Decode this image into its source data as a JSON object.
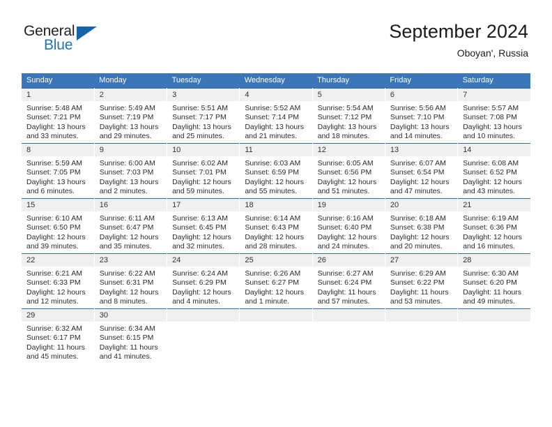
{
  "brand": {
    "name_top": "General",
    "name_bottom": "Blue",
    "triangle_color": "#1565a8",
    "blue_text_color": "#1d72b8"
  },
  "header": {
    "title": "September 2024",
    "subtitle": "Oboyan', Russia"
  },
  "calendar": {
    "header_bg": "#3a76b8",
    "header_text_color": "#ffffff",
    "row_divider_color": "#2e6da4",
    "daynum_band_bg": "#f0f0f0",
    "weekdays": [
      "Sunday",
      "Monday",
      "Tuesday",
      "Wednesday",
      "Thursday",
      "Friday",
      "Saturday"
    ],
    "weeks": [
      [
        {
          "day": "1",
          "sunrise": "Sunrise: 5:48 AM",
          "sunset": "Sunset: 7:21 PM",
          "daylight_line1": "Daylight: 13 hours",
          "daylight_line2": "and 33 minutes."
        },
        {
          "day": "2",
          "sunrise": "Sunrise: 5:49 AM",
          "sunset": "Sunset: 7:19 PM",
          "daylight_line1": "Daylight: 13 hours",
          "daylight_line2": "and 29 minutes."
        },
        {
          "day": "3",
          "sunrise": "Sunrise: 5:51 AM",
          "sunset": "Sunset: 7:17 PM",
          "daylight_line1": "Daylight: 13 hours",
          "daylight_line2": "and 25 minutes."
        },
        {
          "day": "4",
          "sunrise": "Sunrise: 5:52 AM",
          "sunset": "Sunset: 7:14 PM",
          "daylight_line1": "Daylight: 13 hours",
          "daylight_line2": "and 21 minutes."
        },
        {
          "day": "5",
          "sunrise": "Sunrise: 5:54 AM",
          "sunset": "Sunset: 7:12 PM",
          "daylight_line1": "Daylight: 13 hours",
          "daylight_line2": "and 18 minutes."
        },
        {
          "day": "6",
          "sunrise": "Sunrise: 5:56 AM",
          "sunset": "Sunset: 7:10 PM",
          "daylight_line1": "Daylight: 13 hours",
          "daylight_line2": "and 14 minutes."
        },
        {
          "day": "7",
          "sunrise": "Sunrise: 5:57 AM",
          "sunset": "Sunset: 7:08 PM",
          "daylight_line1": "Daylight: 13 hours",
          "daylight_line2": "and 10 minutes."
        }
      ],
      [
        {
          "day": "8",
          "sunrise": "Sunrise: 5:59 AM",
          "sunset": "Sunset: 7:05 PM",
          "daylight_line1": "Daylight: 13 hours",
          "daylight_line2": "and 6 minutes."
        },
        {
          "day": "9",
          "sunrise": "Sunrise: 6:00 AM",
          "sunset": "Sunset: 7:03 PM",
          "daylight_line1": "Daylight: 13 hours",
          "daylight_line2": "and 2 minutes."
        },
        {
          "day": "10",
          "sunrise": "Sunrise: 6:02 AM",
          "sunset": "Sunset: 7:01 PM",
          "daylight_line1": "Daylight: 12 hours",
          "daylight_line2": "and 59 minutes."
        },
        {
          "day": "11",
          "sunrise": "Sunrise: 6:03 AM",
          "sunset": "Sunset: 6:59 PM",
          "daylight_line1": "Daylight: 12 hours",
          "daylight_line2": "and 55 minutes."
        },
        {
          "day": "12",
          "sunrise": "Sunrise: 6:05 AM",
          "sunset": "Sunset: 6:56 PM",
          "daylight_line1": "Daylight: 12 hours",
          "daylight_line2": "and 51 minutes."
        },
        {
          "day": "13",
          "sunrise": "Sunrise: 6:07 AM",
          "sunset": "Sunset: 6:54 PM",
          "daylight_line1": "Daylight: 12 hours",
          "daylight_line2": "and 47 minutes."
        },
        {
          "day": "14",
          "sunrise": "Sunrise: 6:08 AM",
          "sunset": "Sunset: 6:52 PM",
          "daylight_line1": "Daylight: 12 hours",
          "daylight_line2": "and 43 minutes."
        }
      ],
      [
        {
          "day": "15",
          "sunrise": "Sunrise: 6:10 AM",
          "sunset": "Sunset: 6:50 PM",
          "daylight_line1": "Daylight: 12 hours",
          "daylight_line2": "and 39 minutes."
        },
        {
          "day": "16",
          "sunrise": "Sunrise: 6:11 AM",
          "sunset": "Sunset: 6:47 PM",
          "daylight_line1": "Daylight: 12 hours",
          "daylight_line2": "and 35 minutes."
        },
        {
          "day": "17",
          "sunrise": "Sunrise: 6:13 AM",
          "sunset": "Sunset: 6:45 PM",
          "daylight_line1": "Daylight: 12 hours",
          "daylight_line2": "and 32 minutes."
        },
        {
          "day": "18",
          "sunrise": "Sunrise: 6:14 AM",
          "sunset": "Sunset: 6:43 PM",
          "daylight_line1": "Daylight: 12 hours",
          "daylight_line2": "and 28 minutes."
        },
        {
          "day": "19",
          "sunrise": "Sunrise: 6:16 AM",
          "sunset": "Sunset: 6:40 PM",
          "daylight_line1": "Daylight: 12 hours",
          "daylight_line2": "and 24 minutes."
        },
        {
          "day": "20",
          "sunrise": "Sunrise: 6:18 AM",
          "sunset": "Sunset: 6:38 PM",
          "daylight_line1": "Daylight: 12 hours",
          "daylight_line2": "and 20 minutes."
        },
        {
          "day": "21",
          "sunrise": "Sunrise: 6:19 AM",
          "sunset": "Sunset: 6:36 PM",
          "daylight_line1": "Daylight: 12 hours",
          "daylight_line2": "and 16 minutes."
        }
      ],
      [
        {
          "day": "22",
          "sunrise": "Sunrise: 6:21 AM",
          "sunset": "Sunset: 6:33 PM",
          "daylight_line1": "Daylight: 12 hours",
          "daylight_line2": "and 12 minutes."
        },
        {
          "day": "23",
          "sunrise": "Sunrise: 6:22 AM",
          "sunset": "Sunset: 6:31 PM",
          "daylight_line1": "Daylight: 12 hours",
          "daylight_line2": "and 8 minutes."
        },
        {
          "day": "24",
          "sunrise": "Sunrise: 6:24 AM",
          "sunset": "Sunset: 6:29 PM",
          "daylight_line1": "Daylight: 12 hours",
          "daylight_line2": "and 4 minutes."
        },
        {
          "day": "25",
          "sunrise": "Sunrise: 6:26 AM",
          "sunset": "Sunset: 6:27 PM",
          "daylight_line1": "Daylight: 12 hours",
          "daylight_line2": "and 1 minute."
        },
        {
          "day": "26",
          "sunrise": "Sunrise: 6:27 AM",
          "sunset": "Sunset: 6:24 PM",
          "daylight_line1": "Daylight: 11 hours",
          "daylight_line2": "and 57 minutes."
        },
        {
          "day": "27",
          "sunrise": "Sunrise: 6:29 AM",
          "sunset": "Sunset: 6:22 PM",
          "daylight_line1": "Daylight: 11 hours",
          "daylight_line2": "and 53 minutes."
        },
        {
          "day": "28",
          "sunrise": "Sunrise: 6:30 AM",
          "sunset": "Sunset: 6:20 PM",
          "daylight_line1": "Daylight: 11 hours",
          "daylight_line2": "and 49 minutes."
        }
      ],
      [
        {
          "day": "29",
          "sunrise": "Sunrise: 6:32 AM",
          "sunset": "Sunset: 6:17 PM",
          "daylight_line1": "Daylight: 11 hours",
          "daylight_line2": "and 45 minutes."
        },
        {
          "day": "30",
          "sunrise": "Sunrise: 6:34 AM",
          "sunset": "Sunset: 6:15 PM",
          "daylight_line1": "Daylight: 11 hours",
          "daylight_line2": "and 41 minutes."
        },
        {
          "day": "",
          "sunrise": "",
          "sunset": "",
          "daylight_line1": "",
          "daylight_line2": ""
        },
        {
          "day": "",
          "sunrise": "",
          "sunset": "",
          "daylight_line1": "",
          "daylight_line2": ""
        },
        {
          "day": "",
          "sunrise": "",
          "sunset": "",
          "daylight_line1": "",
          "daylight_line2": ""
        },
        {
          "day": "",
          "sunrise": "",
          "sunset": "",
          "daylight_line1": "",
          "daylight_line2": ""
        },
        {
          "day": "",
          "sunrise": "",
          "sunset": "",
          "daylight_line1": "",
          "daylight_line2": ""
        }
      ]
    ]
  }
}
